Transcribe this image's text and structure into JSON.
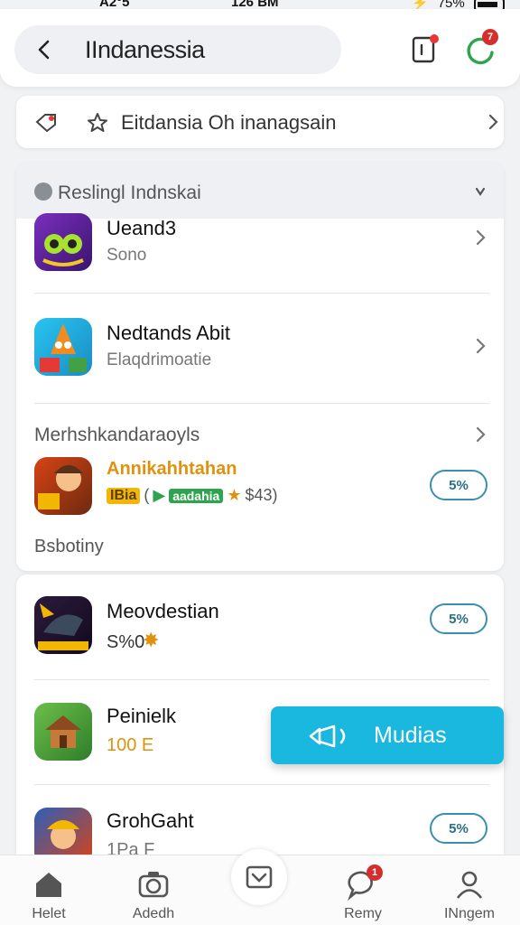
{
  "status": {
    "carrier": "A2°5",
    "time": "126 BM",
    "battery": "75%"
  },
  "header": {
    "title": "IIndanessia",
    "update_badge": "7"
  },
  "banner": {
    "text": "Eitdansia Oh inanagsain"
  },
  "section": {
    "title": "Reslingl Indnskai"
  },
  "apps": [
    {
      "name": "Ueand3",
      "sub": "Sono"
    },
    {
      "name": "Nedtands Abit",
      "sub": "Elaqdrimoatie"
    }
  ],
  "promo": {
    "heading": "Merhshkandaraoyls",
    "name": "Annikahhtahan",
    "tag_yellow": "IBia",
    "tag_green": "aadahia",
    "rating": "$43)",
    "price": "5%",
    "footer": "Bsbotiny"
  },
  "apps2": [
    {
      "name": "Meovdestian",
      "sub": "S%0",
      "price": "5%"
    },
    {
      "name": "Peinielk",
      "sub": "100 E"
    },
    {
      "name": "GrohGaht",
      "sub": "1Pa F",
      "price": "5%"
    }
  ],
  "fab": {
    "label": "Mudias"
  },
  "nav": {
    "items": [
      {
        "label": "Helet",
        "icon": "home-icon"
      },
      {
        "label": "Adedh",
        "icon": "camera-icon"
      },
      {
        "label": "",
        "icon": "inbox-icon"
      },
      {
        "label": "Remy",
        "icon": "chat-icon",
        "badge": "1"
      },
      {
        "label": "INngem",
        "icon": "profile-icon"
      }
    ]
  },
  "colors": {
    "accent": "#1ab8de",
    "badge": "#d32f2f",
    "promo": "#e0920e"
  }
}
